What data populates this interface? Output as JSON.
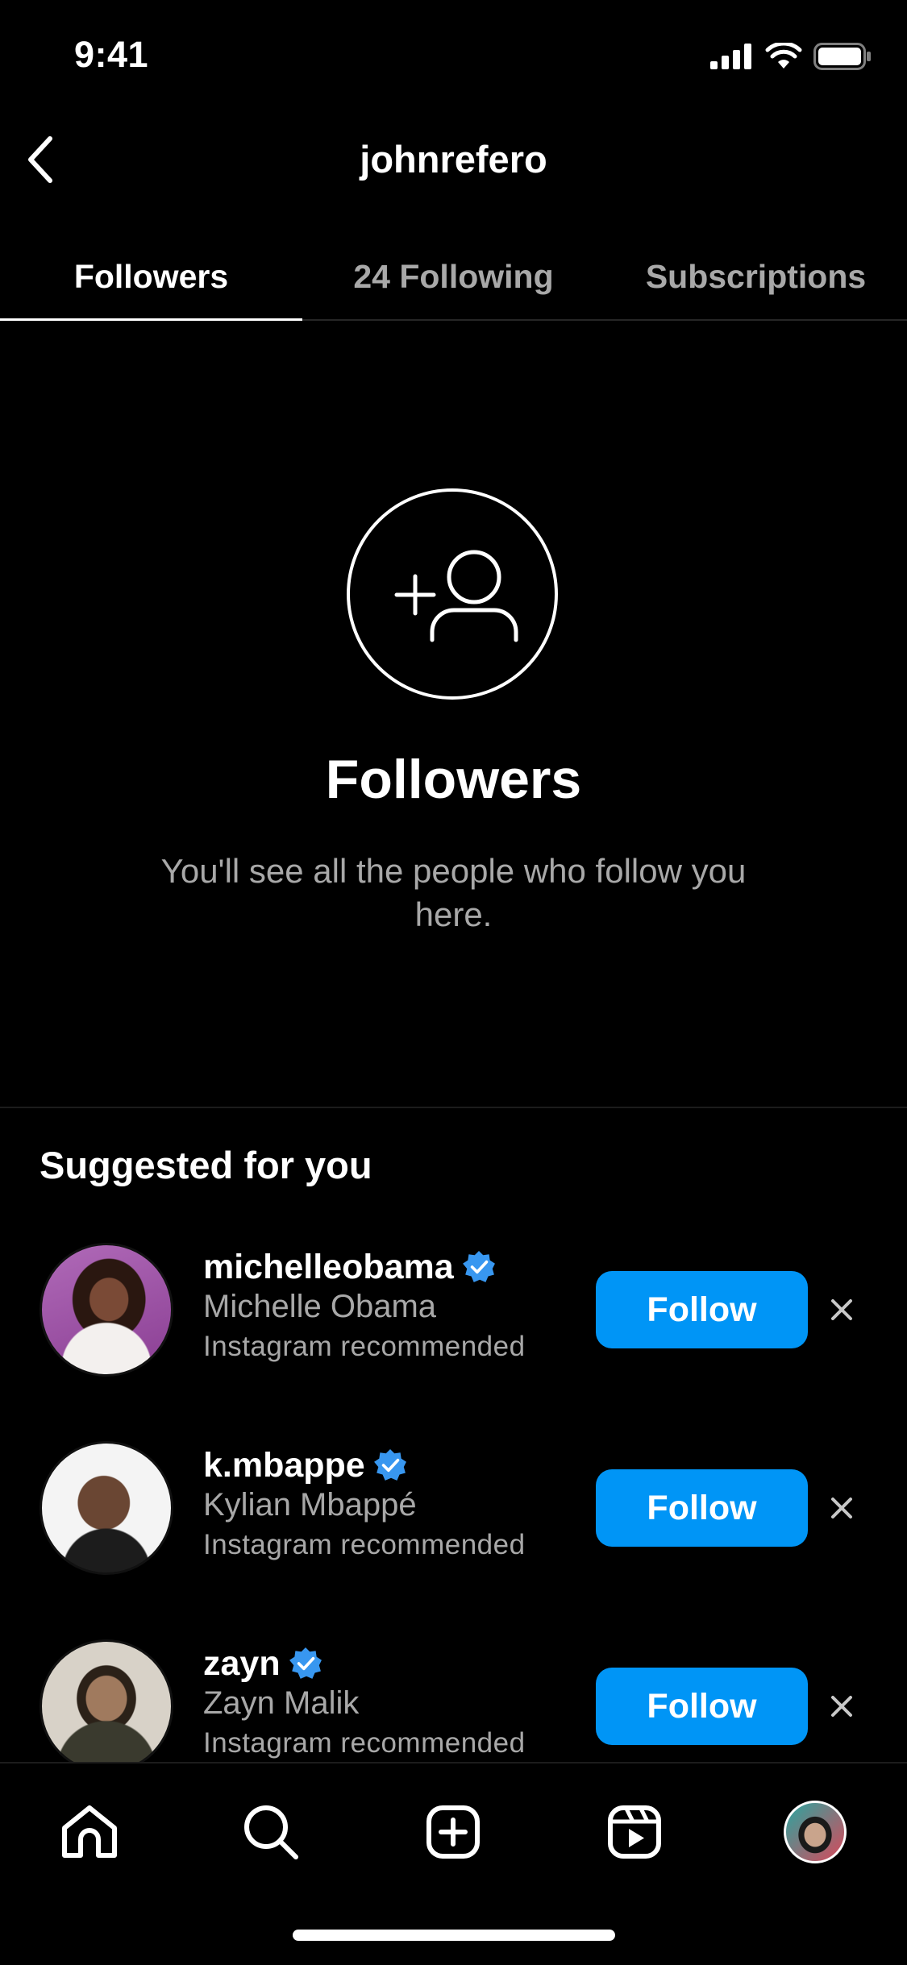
{
  "status_bar": {
    "time": "9:41"
  },
  "header": {
    "title": "johnrefero"
  },
  "tabs": [
    {
      "label": "Followers",
      "active": true
    },
    {
      "label": "24 Following",
      "active": false
    },
    {
      "label": "Subscriptions",
      "active": false
    }
  ],
  "empty_state": {
    "icon": "add-person-icon",
    "title": "Followers",
    "description": "You'll see all the people who follow you here."
  },
  "suggested": {
    "title": "Suggested for you",
    "items": [
      {
        "username": "michelleobama",
        "name": "Michelle Obama",
        "note": "Instagram recommended",
        "verified": true,
        "button": "Follow"
      },
      {
        "username": "k.mbappe",
        "name": "Kylian Mbappé",
        "note": "Instagram recommended",
        "verified": true,
        "button": "Follow"
      },
      {
        "username": "zayn",
        "name": "Zayn Malik",
        "note": "Instagram recommended",
        "verified": true,
        "button": "Follow"
      }
    ]
  },
  "bottom_nav": [
    "home-icon",
    "search-icon",
    "create-icon",
    "reels-icon",
    "profile-avatar"
  ],
  "colors": {
    "background": "#000000",
    "accent": "#0095f6",
    "secondary_text": "#a8a8a8",
    "verified": "#3897f0"
  }
}
